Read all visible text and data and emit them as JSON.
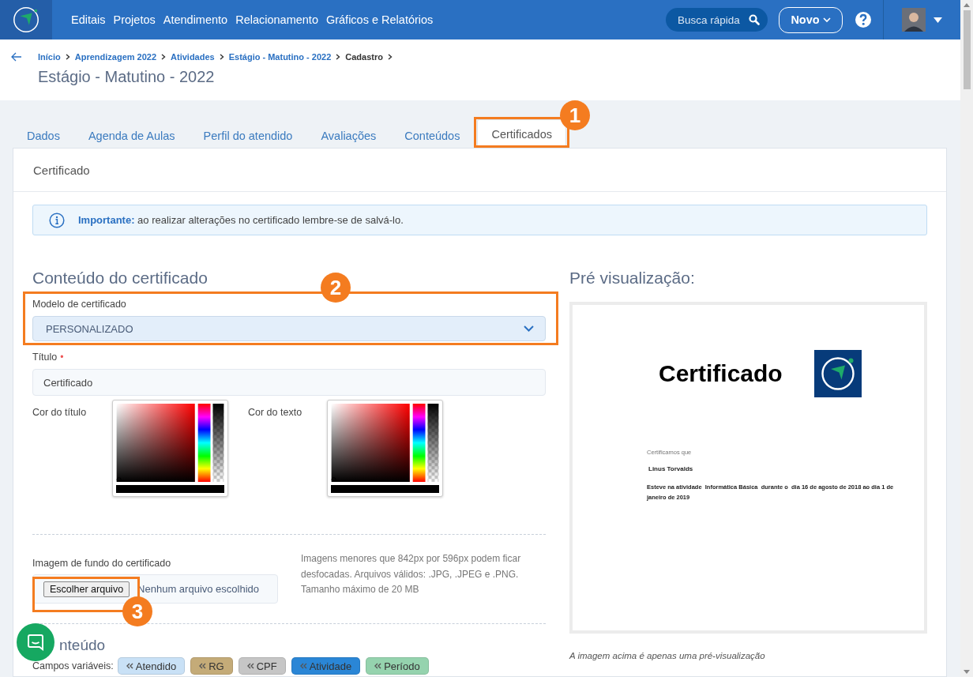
{
  "nav": {
    "links": [
      "Editais",
      "Projetos",
      "Atendimento",
      "Relacionamento",
      "Gráficos e Relatórios"
    ],
    "search": {
      "placeholder": "Busca rápida"
    },
    "new_button": "Novo"
  },
  "breadcrumb": [
    {
      "label": "Início",
      "current": false
    },
    {
      "label": "Aprendizagem 2022",
      "current": false
    },
    {
      "label": "Atividades",
      "current": false
    },
    {
      "label": "Estágio - Matutino - 2022",
      "current": false
    },
    {
      "label": "Cadastro",
      "current": true
    }
  ],
  "page_title": "Estágio - Matutino - 2022",
  "tabs": [
    {
      "label": "Dados",
      "selected": false
    },
    {
      "label": "Agenda de Aulas",
      "selected": false
    },
    {
      "label": "Perfil do atendido",
      "selected": false
    },
    {
      "label": "Avaliações",
      "selected": false
    },
    {
      "label": "Conteúdos",
      "selected": false
    },
    {
      "label": "Certificados",
      "selected": true
    }
  ],
  "card_title": "Certificado",
  "alert": "**Importante:** ao realizar alterações no certificado lembre-se de salvá-lo.",
  "content": {
    "heading": "Conteúdo do certificado",
    "model_label": "Modelo de certificado",
    "model_value": "PERSONALIZADO",
    "title_label": "Título",
    "title_required_mark": "•",
    "title_value": "Certificado",
    "title_color_label": "Cor do título",
    "text_color_label": "Cor do texto",
    "background_label": "Imagem de fundo do certificado",
    "file_button": "Escolher arquivo",
    "file_status": "Nenhum arquivo escolhido",
    "file_hint": "Imagens menores que 842px por 596px podem ficar desfocadas. Arquivos válidos: .JPG, .JPEG e .PNG. Tamanho máximo de 20 MB",
    "section_heading": "nteúdo",
    "variables_label": "Campos variáveis:",
    "variables": [
      {
        "label": "Atendido",
        "color": "#c9e1f6"
      },
      {
        "label": "RG",
        "color": "#c4ab78"
      },
      {
        "label": "CPF",
        "color": "#c6c6c6"
      },
      {
        "label": "Atividade",
        "color": "#2a86d6"
      },
      {
        "label": "Período",
        "color": "#95d3ae"
      }
    ]
  },
  "preview": {
    "heading": "Pré visualização:",
    "certificate": {
      "title": "Certificado",
      "intro": "Certificamos que",
      "name": "Linus Torvalds",
      "body": "Esteve na atividade  Informática Básica  durante o  dia 16 de agosto de 2018 ao dia 1 de janeiro de 2019"
    },
    "caption": "A imagem acima é apenas uma pré-visualização"
  },
  "annotations": {
    "tabs": "1",
    "model": "2",
    "file": "3"
  }
}
